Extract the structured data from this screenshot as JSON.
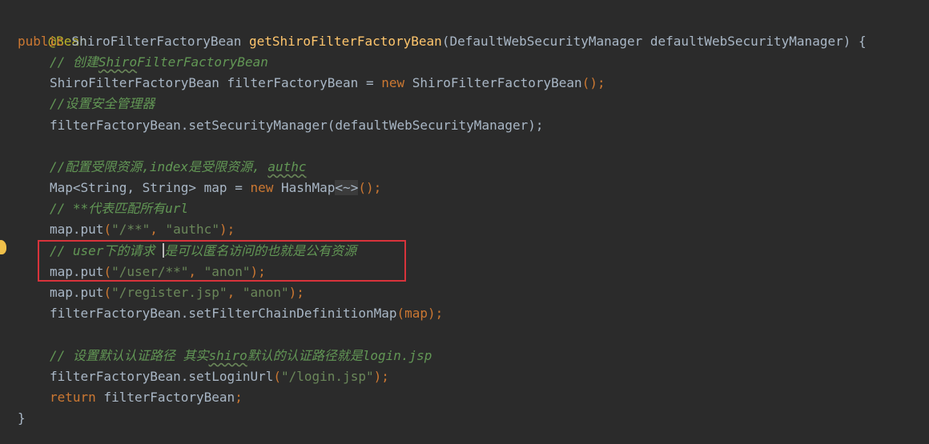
{
  "code": {
    "annotation": "@Bean",
    "l2": {
      "kw": "public",
      "type": " ShiroFilterFactoryBean ",
      "method": "getShiroFilterFactoryBean",
      "params": "(DefaultWebSecurityManager defaultWebSecurityManager) {"
    },
    "l3": {
      "prefix": "// 创建",
      "ul": "Shiro",
      "rest": "FilterFactoryBean"
    },
    "l4": {
      "a": "ShiroFilterFactoryBean filterFactoryBean = ",
      "kw": "new",
      "b": " ShiroFilterFactoryBean",
      "c": "();"
    },
    "l5": "//设置安全管理器",
    "l6": {
      "a": "filterFactoryBean.setSecurityManager",
      "b": "(defaultWebSecurityManager);"
    },
    "l8": {
      "a": "//配置受限资源,index是受限资源, ",
      "ul": "authc"
    },
    "l9": {
      "a": "Map<String, String> map = ",
      "kw": "new",
      "b": " HashMap",
      "d": "<~>",
      "c": "();"
    },
    "l10": "// **代表匹配所有url",
    "l11": {
      "a": "map.put",
      "b": "(",
      "s1": "\"/**\"",
      "sep": ", ",
      "s2": "\"authc\"",
      "c": ");"
    },
    "l12": {
      "a": "// user下的请求 ",
      "b": "是可以匿名访问的也就是公有资源"
    },
    "l13": {
      "a": "map.put",
      "b": "(",
      "s1": "\"/user/**\"",
      "sep": ", ",
      "s2": "\"anon\"",
      "c": ");"
    },
    "l14": {
      "a": "map.put",
      "b": "(",
      "s1": "\"/register.jsp\"",
      "sep": ", ",
      "s2": "\"anon\"",
      "c": ");"
    },
    "l15": {
      "a": "filterFactoryBean.setFilterChainDefinitionMap",
      "b": "(map);"
    },
    "l17": {
      "a": "// 设置默认认证路径 其实",
      "ul": "shiro",
      "b": "默认的认证路径就是login.jsp"
    },
    "l18": {
      "a": "filterFactoryBean.setLoginUrl",
      "b": "(",
      "s1": "\"/login.jsp\"",
      "c": ");"
    },
    "l19": {
      "kw": "return",
      "b": " filterFactoryBean",
      "c": ";"
    },
    "l20": "}"
  },
  "colors": {
    "background": "#2b2b2b",
    "keyword": "#cc7832",
    "method": "#ffc66d",
    "string": "#6a8759",
    "comment": "#629755",
    "annotation": "#bbb529",
    "highlight_box": "#d8333b"
  },
  "icons": {
    "gutter": "lightbulb-icon"
  }
}
